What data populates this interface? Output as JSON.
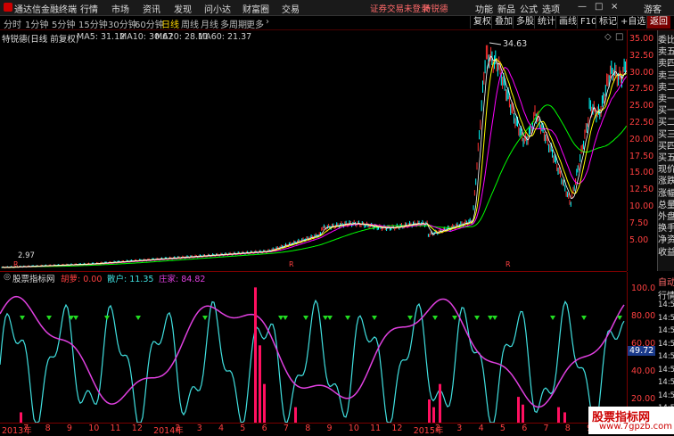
{
  "app": {
    "name": "通达信金融终端",
    "menus": [
      "行情",
      "市场",
      "资讯",
      "发现",
      "问小达",
      "财富圈",
      "交易"
    ],
    "warning": "证券交易未登录",
    "stock_link": "特锐德",
    "right_menus": [
      "功能",
      "新品",
      "公式",
      "选项",
      "游客"
    ],
    "window_controls": [
      "—",
      "□",
      "×"
    ]
  },
  "periods": {
    "items": [
      "分时",
      "1分钟",
      "5分钟",
      "15分钟",
      "30分钟",
      "60分钟",
      "日线",
      "周线",
      "月线",
      "多周期",
      "更多"
    ],
    "active": "日线",
    "more_arrow": "›"
  },
  "toolbar": [
    "复权",
    "叠加",
    "多股",
    "统计",
    "画线",
    "F10",
    "标记",
    "+自选",
    "返回"
  ],
  "stock": {
    "title": "特锐德(日线 前复权)",
    "ma5": "MA5: 31.12",
    "ma10": "MA10: 30.67",
    "ma20": "MA20: 28.11",
    "ma60": "MA60: 21.37",
    "peak_label": "34.63",
    "low_label": "2.97",
    "marker": "R"
  },
  "yaxis_main": [
    "35.00",
    "32.50",
    "30.00",
    "27.50",
    "25.00",
    "22.50",
    "20.00",
    "17.50",
    "15.00",
    "12.50",
    "10.00",
    "7.50",
    "5.00"
  ],
  "right_panel": [
    "委比",
    "卖五",
    "卖四",
    "卖三",
    "卖二",
    "卖一",
    "买一",
    "买二",
    "买三",
    "买四",
    "买五",
    "现价",
    "涨跌",
    "涨幅",
    "总量",
    "外盘",
    "换手",
    "净资",
    "收益"
  ],
  "right_panel_lower": [
    "自动",
    "行情",
    "14:50",
    "14:50",
    "14:50",
    "14:50",
    "14:50",
    "14:50",
    "14:50",
    "14:50",
    "14:50"
  ],
  "indicator": {
    "name": "股票指标网",
    "field1": "胡萝: 0.00",
    "field2": "散户: 11.35",
    "field3": "庄家: 84.82",
    "current": "49.72"
  },
  "yaxis_ind": [
    "100.0",
    "80.00",
    "60.00",
    "40.00",
    "20.00"
  ],
  "xaxis": [
    "2013年",
    "7",
    "8",
    "9",
    "10",
    "11",
    "12",
    "2014年",
    "2",
    "3",
    "4",
    "5",
    "6",
    "7",
    "8",
    "9",
    "10",
    "11",
    "12",
    "2015年",
    "2",
    "3",
    "4",
    "5",
    "6",
    "7",
    "8",
    "9"
  ],
  "watermark": {
    "line1": "股票指标网",
    "line2": "www.7gpzb.com"
  },
  "colors": {
    "ma5": "#ffffff",
    "ma10": "#ffff00",
    "ma20": "#ff00ff",
    "ma60": "#00ff00",
    "up": "#ff3030",
    "down": "#00ffff",
    "retail": "#40e0e0",
    "main": "#e040e0",
    "bars": "#ff1060",
    "signal": "#22dd22"
  }
}
